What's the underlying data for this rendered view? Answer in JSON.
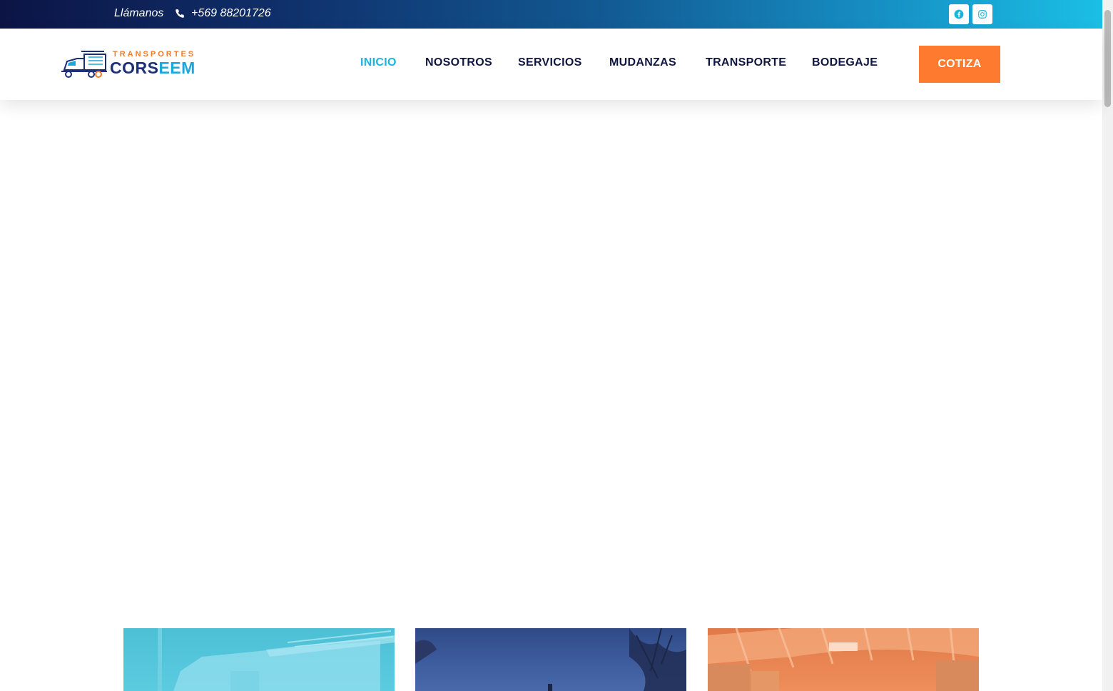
{
  "topbar": {
    "call_label": "Llámanos",
    "phone": "+569 88201726",
    "phone_icon": "phone-icon",
    "social": [
      {
        "name": "facebook-icon"
      },
      {
        "name": "instagram-icon"
      }
    ]
  },
  "logo": {
    "top_text": "TRANSPORTES",
    "main_part1": "CORS",
    "main_part2": "EEM"
  },
  "nav": {
    "items": [
      {
        "label": "INICIO",
        "active": true
      },
      {
        "label": "NOSOTROS",
        "active": false
      },
      {
        "label": "SERVICIOS",
        "active": false
      },
      {
        "label": "MUDANZAS",
        "active": false
      },
      {
        "label": "TRANSPORTE",
        "active": false
      },
      {
        "label": "BODEGAJE",
        "active": false
      }
    ],
    "cta_label": "COTIZA"
  },
  "colors": {
    "accent_cyan": "#1cb4df",
    "nav_dark": "#10163f",
    "cta_orange": "#fd7a2f",
    "topbar_start": "#0c1445",
    "topbar_end": "#1bbfe5"
  }
}
